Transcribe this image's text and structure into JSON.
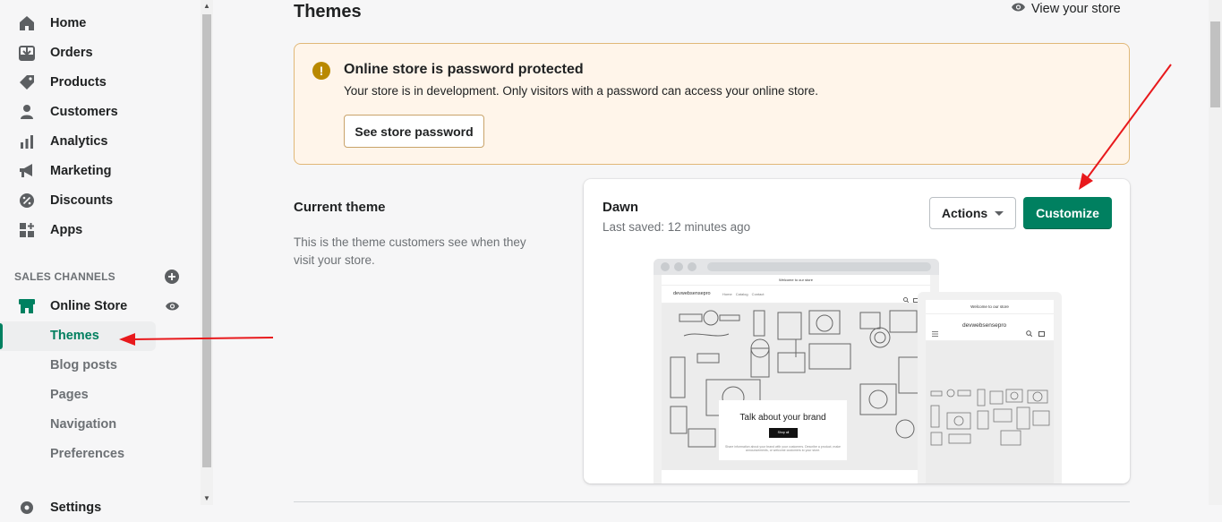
{
  "sidebar": {
    "items": [
      {
        "label": "Home",
        "icon": "home-icon"
      },
      {
        "label": "Orders",
        "icon": "orders-icon"
      },
      {
        "label": "Products",
        "icon": "tag-icon"
      },
      {
        "label": "Customers",
        "icon": "person-icon"
      },
      {
        "label": "Analytics",
        "icon": "bar-chart-icon"
      },
      {
        "label": "Marketing",
        "icon": "megaphone-icon"
      },
      {
        "label": "Discounts",
        "icon": "discount-icon"
      },
      {
        "label": "Apps",
        "icon": "apps-icon"
      }
    ],
    "sales_channels_label": "SALES CHANNELS",
    "online_store_label": "Online Store",
    "sub_items": [
      "Themes",
      "Blog posts",
      "Pages",
      "Navigation",
      "Preferences"
    ],
    "active_sub_item": "Themes",
    "settings_label": "Settings"
  },
  "header": {
    "title": "Themes",
    "view_store_label": "View your store"
  },
  "banner": {
    "title": "Online store is password protected",
    "text": "Your store is in development. Only visitors with a password can access your online store.",
    "button_label": "See store password"
  },
  "current_theme": {
    "section_title": "Current theme",
    "section_desc": "This is the theme customers see when they visit your store.",
    "theme_name": "Dawn",
    "last_saved": "Last saved: 12 minutes ago",
    "actions_label": "Actions",
    "customize_label": "Customize"
  },
  "preview": {
    "desktop_announcement": "Welcome to our store",
    "desktop_logo": "devwebsensepro",
    "desktop_links": "Home Catalog Contact",
    "hero_title": "Talk about your brand",
    "hero_button": "Shop all",
    "hero_sub": "Share information about your brand with your customers. Describe a product, make announcements, or welcome customers to your store.",
    "mobile_announcement": "Welcome to our store",
    "mobile_logo": "devwebsensepro"
  },
  "colors": {
    "primary": "#008060",
    "banner_bg": "#fff5ea",
    "banner_border": "#e1b878",
    "warning_icon": "#b98900",
    "annotation_arrow": "#e8191c"
  }
}
